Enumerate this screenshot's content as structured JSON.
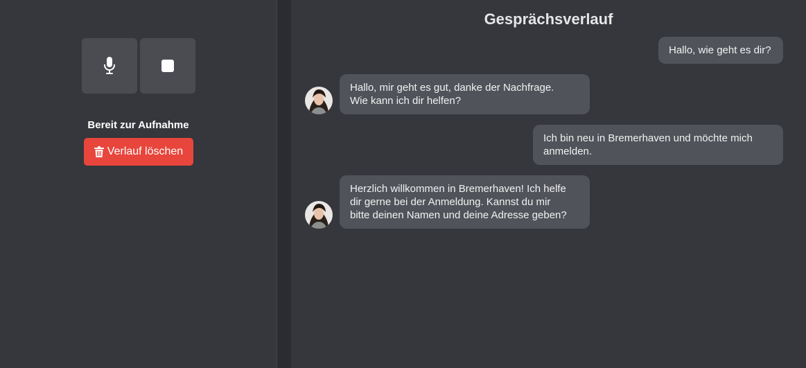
{
  "controls": {
    "record_icon": "microphone-icon",
    "stop_icon": "stop-icon",
    "status": "Bereit zur Aufnahme",
    "clear_icon": "trash-icon",
    "clear_label": "Verlauf löschen"
  },
  "chat": {
    "title": "Gesprächsverlauf",
    "messages": [
      {
        "role": "user",
        "text": "Hallo, wie geht es dir?"
      },
      {
        "role": "assistant",
        "text": "Hallo, mir geht es gut, danke der Nachfrage.\nWie kann ich dir helfen?"
      },
      {
        "role": "user",
        "text": "Ich bin neu in Bremerhaven und möchte mich\nanmelden."
      },
      {
        "role": "assistant",
        "text": "Herzlich willkommen in Bremerhaven! Ich helfe\ndir gerne bei der Anmeldung. Kannst du mir\nbitte deinen Namen und deine Adresse geben?"
      }
    ]
  },
  "colors": {
    "panel": "#35373d",
    "bubble": "#50535a",
    "danger": "#e8453c"
  }
}
